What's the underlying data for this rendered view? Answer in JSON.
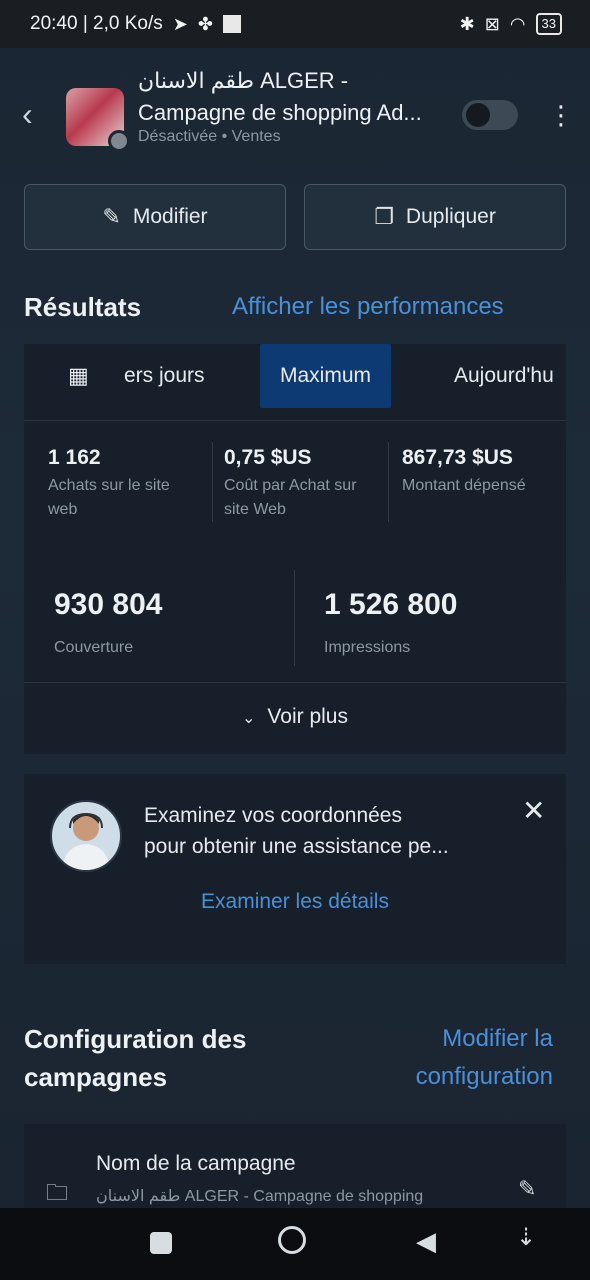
{
  "status_bar": {
    "time_info": "20:40 | 2,0 Ko/s",
    "battery": "33"
  },
  "header": {
    "title_line1": "طقم الاسنان ALGER -",
    "title_line2": "Campagne de shopping Ad...",
    "status": "Désactivée • Ventes"
  },
  "actions": {
    "edit_label": "Modifier",
    "duplicate_label": "Dupliquer"
  },
  "results": {
    "title": "Résultats",
    "link": "Afficher les performances",
    "tabs": [
      {
        "label": "ers jours"
      },
      {
        "label": "Maximum"
      },
      {
        "label": "Aujourd'hu"
      }
    ],
    "metrics": [
      {
        "value": "1 162",
        "label_l1": "Achats sur le site",
        "label_l2": "web"
      },
      {
        "value": "0,75 $US",
        "label_l1": "Coût par Achat sur",
        "label_l2": "site Web"
      },
      {
        "value": "867,73 $US",
        "label_l1": "Montant dépensé",
        "label_l2": ""
      }
    ],
    "big_metrics": [
      {
        "value": "930 804",
        "label": "Couverture"
      },
      {
        "value": "1 526 800",
        "label": "Impressions"
      }
    ],
    "more": "Voir plus"
  },
  "assistance": {
    "text_l1": "Examinez vos coordonnées",
    "text_l2": "pour obtenir une assistance pe...",
    "link": "Examiner les détails"
  },
  "config": {
    "title_l1": "Configuration des",
    "title_l2": "campagnes",
    "link_l1": "Modifier la",
    "link_l2": "configuration",
    "name_label": "Nom de la campagne",
    "name_value": "طقم الاسنان ALGER - Campagne de shopping"
  }
}
